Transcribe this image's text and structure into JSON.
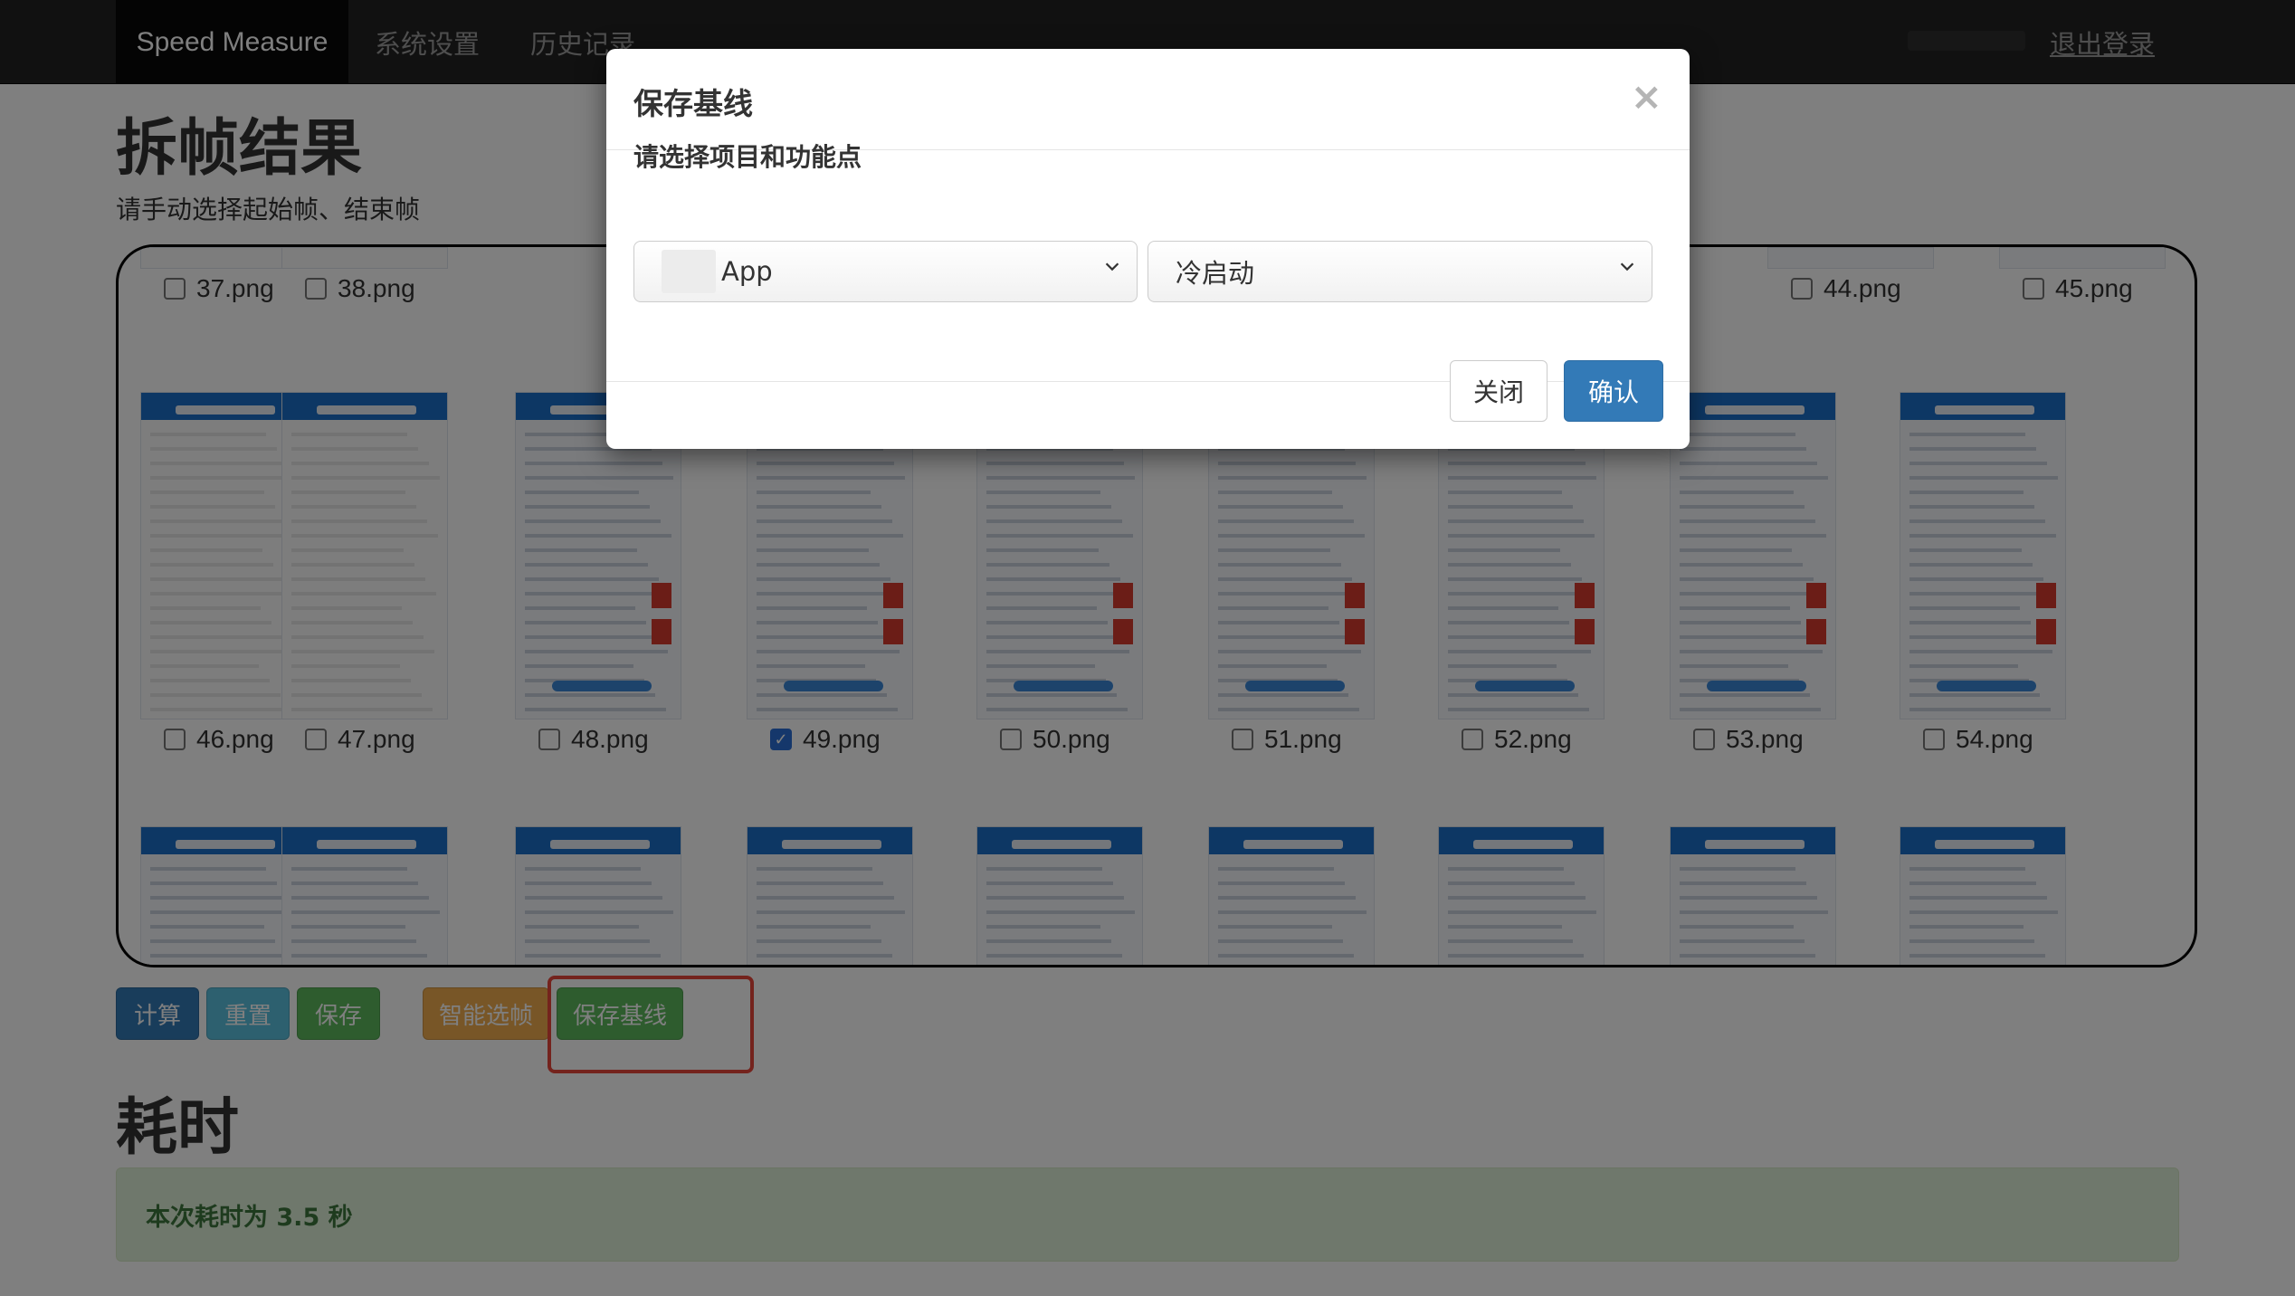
{
  "navbar": {
    "brand": "Speed Measure",
    "links": [
      "系统设置",
      "历史记录"
    ],
    "logout": "退出登录"
  },
  "page": {
    "title": "拆帧结果",
    "subtitle": "请手动选择起始帧、结束帧"
  },
  "frames": {
    "row1": [
      "37.png",
      "38.png",
      "44.png",
      "45.png"
    ],
    "row2": [
      {
        "label": "46.png",
        "checked": false
      },
      {
        "label": "47.png",
        "checked": false
      },
      {
        "label": "48.png",
        "checked": false
      },
      {
        "label": "49.png",
        "checked": true
      },
      {
        "label": "50.png",
        "checked": false
      },
      {
        "label": "51.png",
        "checked": false
      },
      {
        "label": "52.png",
        "checked": false
      },
      {
        "label": "53.png",
        "checked": false
      },
      {
        "label": "54.png",
        "checked": false
      }
    ]
  },
  "actions": {
    "calc": "计算",
    "reset": "重置",
    "save": "保存",
    "smart": "智能选帧",
    "baseline": "保存基线"
  },
  "elapsed": {
    "title": "耗时",
    "message": "本次耗时为 3.5 秒"
  },
  "modal": {
    "title": "保存基线",
    "close_glyph": "×",
    "label": "请选择项目和功能点",
    "project_select": "App",
    "feature_select": "冷启动",
    "close_btn": "关闭",
    "confirm_btn": "确认"
  },
  "colors": {
    "primary": "#337ab7",
    "info": "#5bc0de",
    "success": "#5cb85c",
    "warning": "#f0ad4e",
    "highlight": "#e8463a"
  }
}
